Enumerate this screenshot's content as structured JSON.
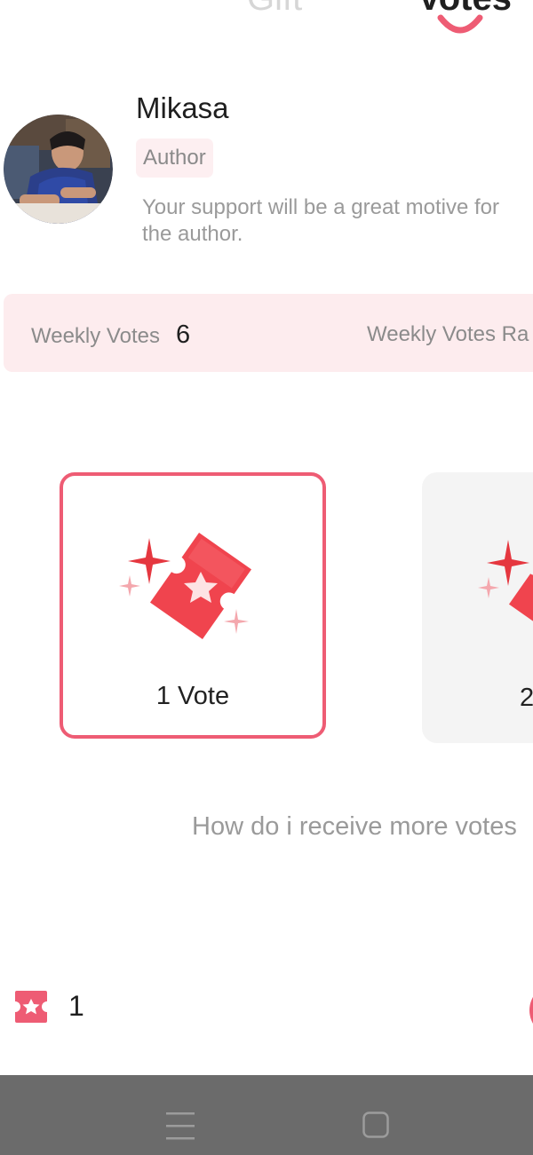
{
  "tabs": {
    "gift_label": "Gift",
    "votes_label": "Votes",
    "active_tab": "votes"
  },
  "author": {
    "name": "Mikasa",
    "badge": "Author",
    "description": "Your support will be a great motive for the author."
  },
  "weekly": {
    "votes_label": "Weekly Votes",
    "votes_count": "6",
    "ranking_label": "Weekly Votes Ra"
  },
  "vote_options": [
    {
      "label": "1 Vote",
      "selected": true
    },
    {
      "label": "2",
      "selected": false
    }
  ],
  "help_link": "How do i receive more votes",
  "balance": {
    "ticket_count": "1"
  },
  "colors": {
    "accent": "#ee5c74",
    "badge_bg": "#fdeff1",
    "weekly_bar_bg": "#fdecee",
    "card_unselected_bg": "#f4f4f4",
    "system_nav_bg": "#6b6b6b"
  },
  "icons": {
    "ticket": "vote-ticket-icon",
    "sparkle": "sparkle-icon",
    "menu": "recent-apps-icon",
    "home": "home-icon"
  }
}
